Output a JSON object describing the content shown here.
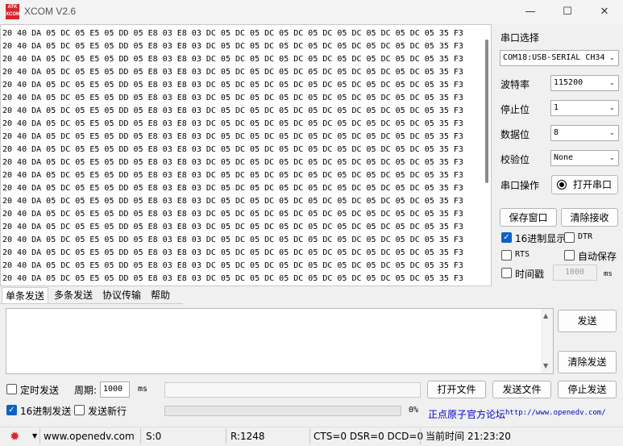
{
  "window": {
    "title": "XCOM V2.6",
    "logo_text_top": "ATK",
    "logo_text_bottom": "XCOM",
    "minimize_glyph": "—",
    "maximize_glyph": "☐",
    "close_glyph": "✕"
  },
  "receive": {
    "line": "20 40 DA 05 DC 05 E5 05 DD 05 E8 03 E8 03 DC 05 DC 05 DC 05 DC 05 DC 05 DC 05 DC 05 DC 05 35 F3",
    "line_count": 20
  },
  "serial_config": {
    "port_label": "串口选择",
    "port_value": "COM18:USB-SERIAL CH34",
    "baud_label": "波特率",
    "baud_value": "115200",
    "stop_label": "停止位",
    "stop_value": "1",
    "data_label": "数据位",
    "data_value": "8",
    "parity_label": "校验位",
    "parity_value": "None",
    "op_label": "串口操作",
    "open_button": "打开串口"
  },
  "actions": {
    "save_window": "保存窗口",
    "clear_receive": "清除接收",
    "hex_display": "16进制显示",
    "hex_display_checked": true,
    "dtr": "DTR",
    "rts": "RTS",
    "auto_save": "自动保存",
    "timestamp": "时间戳",
    "timestamp_value": "1000",
    "timestamp_unit": "ms"
  },
  "tabs": [
    "单条发送",
    "多条发送",
    "协议传输",
    "帮助"
  ],
  "send": {
    "send_button": "发送",
    "clear_send_button": "清除发送",
    "timed_send": "定时发送",
    "period_label": "周期:",
    "period_value": "1000",
    "period_unit": "ms",
    "open_file": "打开文件",
    "send_file": "发送文件",
    "stop_send": "停止发送",
    "hex_send": "16进制发送",
    "hex_send_checked": true,
    "send_newline": "发送新行",
    "progress": "0%",
    "progress_value": 0,
    "forum_text": "正点原子官方论坛",
    "forum_url": "http://www.openedv.com/"
  },
  "statusbar": {
    "website": "www.openedv.com",
    "sent": "S:0",
    "received": "R:1248",
    "signals": "CTS=0 DSR=0 DCD=0",
    "time_label": "当前时间",
    "time_value": "21:23:20"
  }
}
